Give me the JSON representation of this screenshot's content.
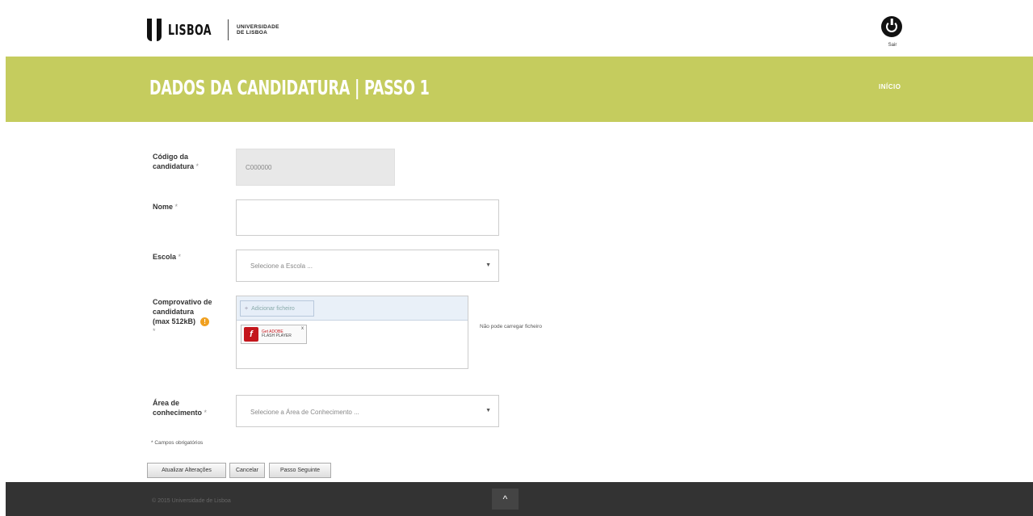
{
  "header": {
    "logo_lisboa": "LISBOA",
    "logo_univ_line1": "UNIVERSIDADE",
    "logo_univ_line2": "DE LISBOA",
    "logout_label": "Sair"
  },
  "banner": {
    "title": "DADOS DA CANDIDATURA | PASSO 1",
    "link": "INÍCIO",
    "background": "#c5cc5e"
  },
  "form": {
    "codigo": {
      "label_line1": "Código da",
      "label_line2": "candidatura",
      "required_mark": "*",
      "value": "C000000"
    },
    "nome": {
      "label": "Nome",
      "required_mark": "*",
      "value": ""
    },
    "escola": {
      "label": "Escola",
      "required_mark": "*",
      "selected": "Selecione a Escola ..."
    },
    "comprovativo": {
      "label_line1": "Comprovativo de",
      "label_line2": "candidatura",
      "label_line3": "(max 512kB)",
      "required_mark": "*",
      "info_icon": "!",
      "upload_button": "Adicionar ficheiro",
      "flash_line1": "Get ADOBE",
      "flash_line2": "FLASH PLAYER",
      "flash_close": "x",
      "note": "Não pode carregar ficheiro"
    },
    "area": {
      "label_line1": "Área de",
      "label_line2": "conhecimento",
      "required_mark": "*",
      "selected": "Selecione a Área de Conhecimento ..."
    },
    "required_note": "* Campos obrigatórios"
  },
  "buttons": {
    "save": "Atualizar Alterações",
    "cancel": "Cancelar",
    "next": "Passo Seguinte"
  },
  "footer": {
    "copyright": "© 2015 Universidade de Lisboa",
    "up_icon": "^"
  }
}
